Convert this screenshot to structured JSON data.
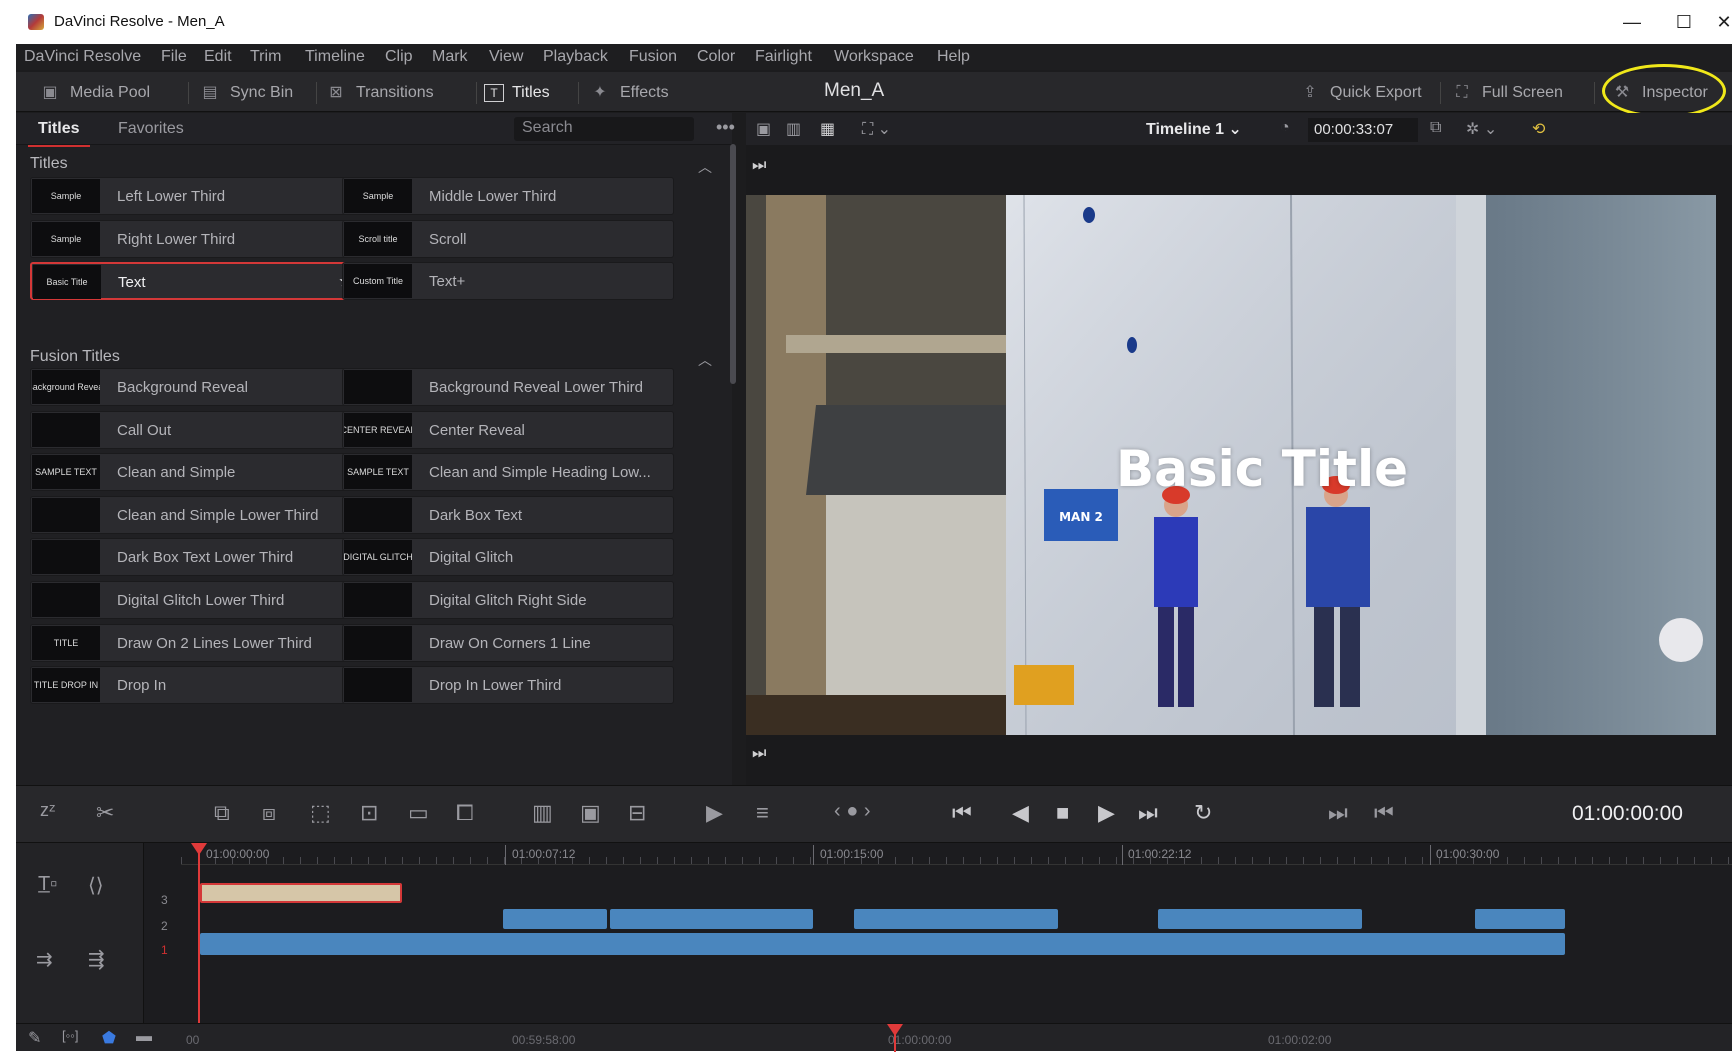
{
  "window": {
    "title": "DaVinci Resolve - Men_A",
    "minimize": "—",
    "maximize": "☐",
    "close": "✕"
  },
  "menu": [
    "DaVinci Resolve",
    "File",
    "Edit",
    "Trim",
    "Timeline",
    "Clip",
    "Mark",
    "View",
    "Playback",
    "Fusion",
    "Color",
    "Fairlight",
    "Workspace",
    "Help"
  ],
  "toolbar": {
    "media_pool": "Media Pool",
    "sync_bin": "Sync Bin",
    "transitions": "Transitions",
    "titles": "Titles",
    "effects": "Effects",
    "project": "Men_A",
    "quick_export": "Quick Export",
    "full_screen": "Full Screen",
    "inspector": "Inspector"
  },
  "effects_panel": {
    "tab_titles": "Titles",
    "tab_favorites": "Favorites",
    "search_placeholder": "Search",
    "section_titles": "Titles",
    "section_fusion": "Fusion Titles",
    "titles": [
      {
        "label": "Left Lower Third",
        "thumb": "Sample"
      },
      {
        "label": "Middle Lower Third",
        "thumb": "Sample"
      },
      {
        "label": "Right Lower Third",
        "thumb": "Sample"
      },
      {
        "label": "Scroll",
        "thumb": "Scroll title"
      },
      {
        "label": "Text",
        "thumb": "Basic Title",
        "selected": true,
        "favorite": true
      },
      {
        "label": "Text+",
        "thumb": "Custom Title"
      }
    ],
    "fusion_titles": [
      {
        "label": "Background Reveal",
        "thumb": "Background Reveal"
      },
      {
        "label": "Background Reveal Lower Third",
        "thumb": ""
      },
      {
        "label": "Call Out",
        "thumb": ""
      },
      {
        "label": "Center Reveal",
        "thumb": "CENTER REVEAL"
      },
      {
        "label": "Clean and Simple",
        "thumb": "SAMPLE TEXT"
      },
      {
        "label": "Clean and Simple Heading Low...",
        "thumb": "SAMPLE TEXT"
      },
      {
        "label": "Clean and Simple Lower Third",
        "thumb": ""
      },
      {
        "label": "Dark Box Text",
        "thumb": ""
      },
      {
        "label": "Dark Box Text Lower Third",
        "thumb": ""
      },
      {
        "label": "Digital Glitch",
        "thumb": "DIGITAL GLITCH"
      },
      {
        "label": "Digital Glitch Lower Third",
        "thumb": ""
      },
      {
        "label": "Digital Glitch Right Side",
        "thumb": ""
      },
      {
        "label": "Draw On 2 Lines Lower Third",
        "thumb": "TITLE"
      },
      {
        "label": "Draw On Corners 1 Line",
        "thumb": ""
      },
      {
        "label": "Drop In",
        "thumb": "TITLE DROP IN"
      },
      {
        "label": "Drop In Lower Third",
        "thumb": ""
      }
    ]
  },
  "viewer": {
    "timeline_name": "Timeline 1",
    "timecode_top": "00:00:33:07",
    "overlay_title": "Basic Title",
    "sign_text": "MAN 2"
  },
  "transport": {
    "timecode": "01:00:00:00"
  },
  "timeline": {
    "ruler": [
      "01:00:00:00",
      "01:00:07:12",
      "01:00:15:00",
      "01:00:22:12",
      "01:00:30:00"
    ],
    "tracks": [
      "3",
      "2",
      "1"
    ],
    "clip_colors": {
      "title": "#d6c6a8",
      "video": "#4a86be",
      "playhead": "#e03a3a"
    }
  },
  "bottom_ruler": [
    "00",
    "00:59:58:00",
    "01:00:00:00",
    "01:00:02:00"
  ],
  "colors": {
    "accent_red": "#d43838",
    "highlight_yellow": "#f0e81a",
    "bg": "#1c1c1e"
  }
}
